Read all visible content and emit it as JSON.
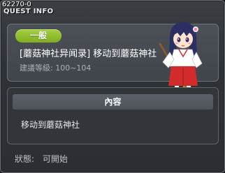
{
  "window": {
    "quest_id": "62270-0",
    "title": "QUEST INFO"
  },
  "quest": {
    "category_badge": "一般",
    "name": "[蘑菇神社异闻录] 移动到蘑菇神社",
    "level_label": "建議等級:",
    "level_range": "100~104"
  },
  "content": {
    "header": "內容",
    "text": "移动到蘑菇神社"
  },
  "status": {
    "label": "狀態:",
    "value": "可開始"
  },
  "icons": {
    "portrait": "shrine-maiden-npc-icon"
  }
}
